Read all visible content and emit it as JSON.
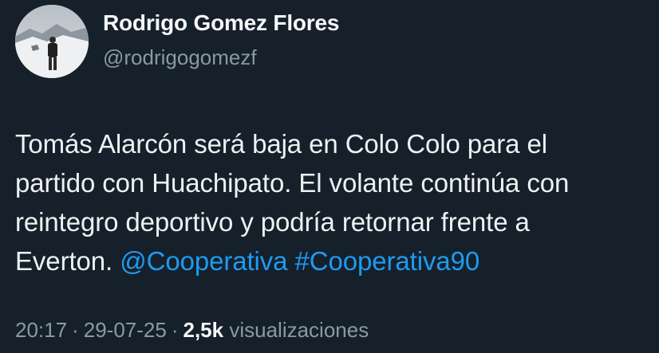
{
  "author": {
    "name": "Rodrigo Gomez Flores",
    "handle": "@rodrigogomezf"
  },
  "tweet": {
    "line1": "Tomás Alarcón será baja en Colo Colo para el",
    "line2": "partido con Huachipato. El volante continúa con",
    "line3": "reintegro deportivo y podría retornar frente a",
    "line4_text": "Everton.",
    "mention": "@Cooperativa",
    "hashtag": "#Cooperativa90"
  },
  "meta": {
    "time": "20:17",
    "date": "29-07-25",
    "separator": "·",
    "views_count": "2,5k",
    "views_label": "visualizaciones"
  },
  "colors": {
    "background": "#15202b",
    "link": "#1d9bf0",
    "secondary_text": "#8b98a5"
  }
}
